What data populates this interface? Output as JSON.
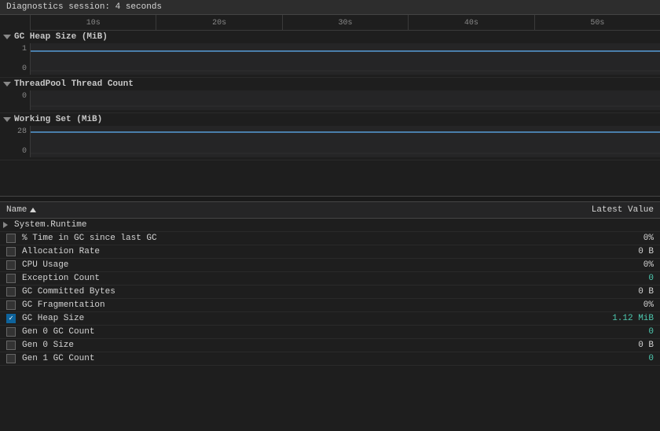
{
  "header": {
    "title": "Diagnostics session: 4 seconds"
  },
  "timeline": {
    "ticks": [
      "10s",
      "20s",
      "30s",
      "40s",
      "50s"
    ],
    "charts": [
      {
        "id": "gc-heap-size",
        "label": "GC Heap Size (MiB)",
        "yMax": "1",
        "yMin": "0",
        "hasLine": true
      },
      {
        "id": "threadpool",
        "label": "ThreadPool Thread Count",
        "yMax": "0",
        "yMin": "",
        "hasLine": false
      },
      {
        "id": "working-set",
        "label": "Working Set (MiB)",
        "yMax": "28",
        "yMin": "0",
        "hasLine": true
      }
    ]
  },
  "table": {
    "col_name": "Name",
    "col_value": "Latest Value",
    "group": "System.Runtime",
    "rows": [
      {
        "name": "% Time in GC since last GC",
        "value": "0%",
        "checked": false
      },
      {
        "name": "Allocation Rate",
        "value": "0 B",
        "checked": false
      },
      {
        "name": "CPU Usage",
        "value": "0%",
        "checked": false
      },
      {
        "name": "Exception Count",
        "value": "0",
        "checked": false,
        "highlight": true
      },
      {
        "name": "GC Committed Bytes",
        "value": "0 B",
        "checked": false
      },
      {
        "name": "GC Fragmentation",
        "value": "0%",
        "checked": false
      },
      {
        "name": "GC Heap Size",
        "value": "1.12 MiB",
        "checked": true,
        "highlight": true
      },
      {
        "name": "Gen 0 GC Count",
        "value": "0",
        "checked": false,
        "highlight": true
      },
      {
        "name": "Gen 0 Size",
        "value": "0 B",
        "checked": false
      },
      {
        "name": "Gen 1 GC Count",
        "value": "0",
        "checked": false,
        "highlight": true
      }
    ]
  }
}
